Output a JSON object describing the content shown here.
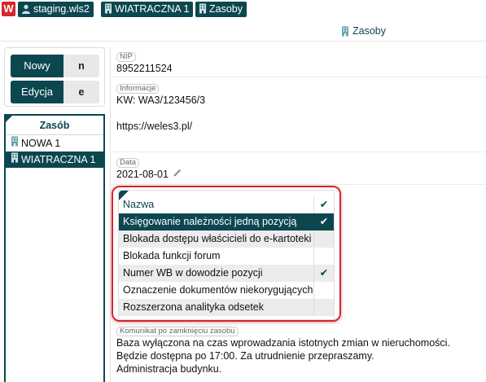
{
  "topbar": {
    "logo_letter": "W",
    "crumbs": [
      {
        "label": "staging.wls2",
        "icon": "user-icon"
      },
      {
        "label": "WIATRACZNA 1",
        "icon": "building-icon"
      },
      {
        "label": "Zasoby",
        "icon": "building-icon"
      }
    ]
  },
  "page_title": "Zasoby",
  "actions": {
    "new_label": "Nowy",
    "new_key": "n",
    "edit_label": "Edycja",
    "edit_key": "e"
  },
  "resource_list": {
    "header": "Zasób",
    "items": [
      {
        "label": "NOWA 1",
        "selected": false
      },
      {
        "label": "WIATRACZNA 1",
        "selected": true
      }
    ]
  },
  "details": {
    "nip_label": "NIP",
    "nip_value": "8952211524",
    "info_label": "Informacje",
    "info_line1": "KW: WA3/123456/3",
    "info_line2": "https://weles3.pl/",
    "date_label": "Data",
    "date_value": "2021-08-01",
    "closing_label": "Komunikat po zamknięciu zasobu",
    "closing_line1": "Baza wyłączona na czas wprowadzania istotnych zmian w nieruchomości.",
    "closing_line2": "Będzie dostępna po 17:00. Za utrudnienie przepraszamy.",
    "closing_line3": "Administracja budynku."
  },
  "features": {
    "header": "Nazwa",
    "header_check": "✔",
    "rows": [
      {
        "label": "Księgowanie należności jedną pozycją",
        "checked": true,
        "selected": true
      },
      {
        "label": "Blokada dostępu właścicieli do e-kartoteki",
        "checked": false,
        "selected": false
      },
      {
        "label": "Blokada funkcji forum",
        "checked": false,
        "selected": false
      },
      {
        "label": "Numer WB w dowodzie pozycji",
        "checked": true,
        "selected": false
      },
      {
        "label": "Oznaczenie dokumentów niekorygujących",
        "checked": false,
        "selected": false
      },
      {
        "label": "Rozszerzona analityka odsetek",
        "checked": false,
        "selected": false
      }
    ],
    "check_glyph": "✔"
  },
  "colors": {
    "accent": "#0c4750",
    "highlight_border": "#d9232c",
    "logo": "#d6262b"
  }
}
